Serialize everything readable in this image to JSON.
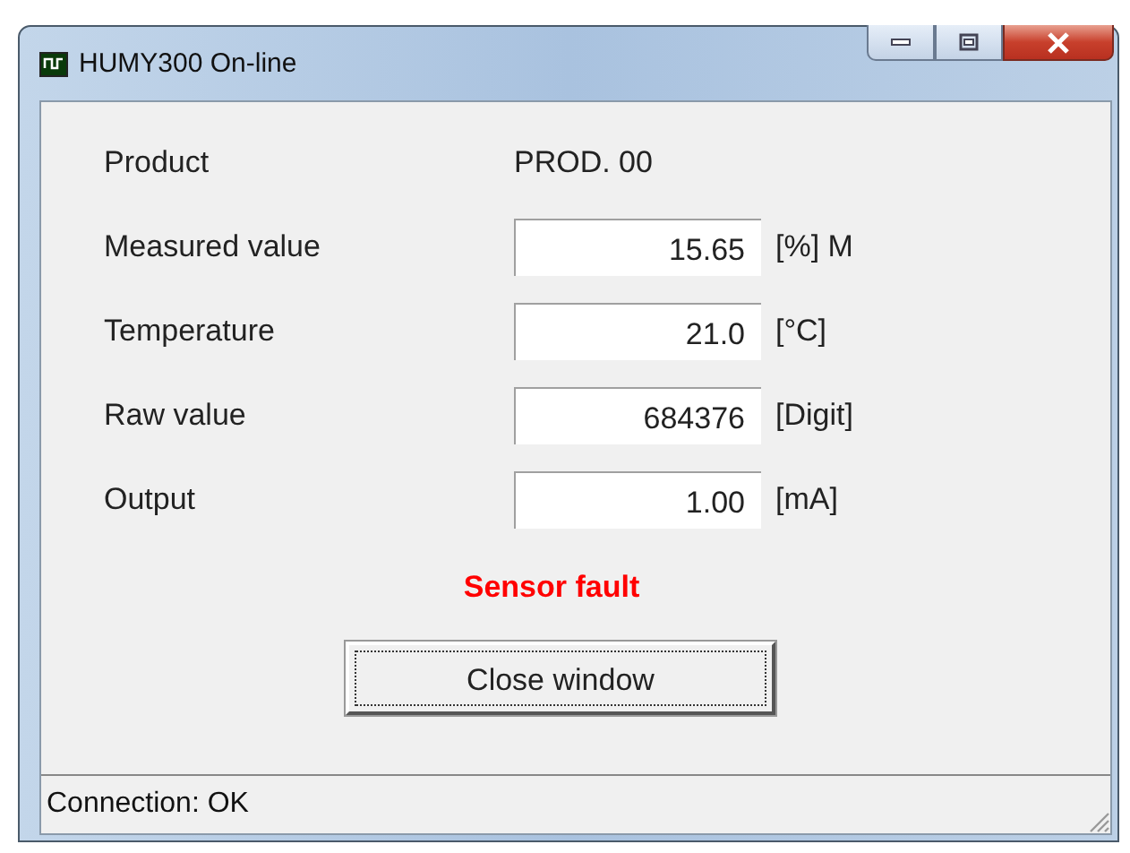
{
  "window": {
    "title": "HUMY300 On-line"
  },
  "rows": [
    {
      "kind": "text",
      "label": "Product",
      "value": "PROD. 00"
    },
    {
      "kind": "field",
      "label": "Measured value",
      "value": "15.65",
      "unit": "[%] M"
    },
    {
      "kind": "field",
      "label": "Temperature",
      "value": "21.0",
      "unit": "[°C]"
    },
    {
      "kind": "field",
      "label": "Raw value",
      "value": "684376",
      "unit": "[Digit]"
    },
    {
      "kind": "field",
      "label": "Output",
      "value": "1.00",
      "unit": "[mA]"
    }
  ],
  "message": "Sensor fault",
  "buttons": [
    "Close window"
  ],
  "status_bar": "Connection: OK"
}
